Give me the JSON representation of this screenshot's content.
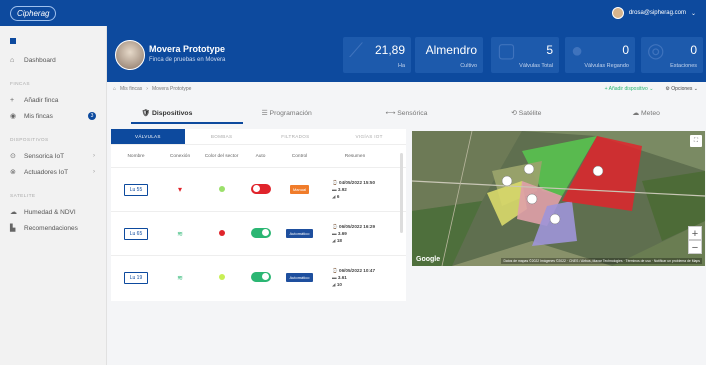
{
  "topbar": {
    "logo": "Cipherag",
    "user_email": "drosa@sipherag.com",
    "user_chevron": "⌄"
  },
  "sidebar": {
    "dashboard": "Dashboard",
    "section_fincas": "FINCAS",
    "add_farm": "Añadir finca",
    "my_farms": "Mis fincas",
    "farms_count": "3",
    "section_dispositivos": "DISPOSITIVOS",
    "sensors": "Sensorica IoT",
    "actuators": "Actuadores IoT",
    "section_satelite": "SATELITE",
    "ndvi": "Humedad & NDVI",
    "recommendations": "Recomendaciones"
  },
  "header": {
    "farm_title": "Movera Prototype",
    "farm_subtitle": "Finca de pruebas en Movera",
    "stats": [
      {
        "value": "21,89",
        "label": "Ha"
      },
      {
        "value": "Almendro",
        "label": "Cultivo"
      },
      {
        "value": "5",
        "label": "Válvulas Total"
      },
      {
        "value": "0",
        "label": "Válvulas Regando"
      },
      {
        "value": "0",
        "label": "Estaciones"
      }
    ]
  },
  "breadcrumb": {
    "home": "Mis fincas",
    "sep": "›",
    "current": "Movera Prototype"
  },
  "actions": {
    "add_device": "+ Añadir dispositivo ⌄",
    "options": "⚙ Opciones ⌄"
  },
  "tabs": [
    "Dispositivos",
    "Programación",
    "Sensórica",
    "Satélite",
    "Meteo"
  ],
  "tab_icons": [
    "🛡",
    "☰",
    "⟷",
    "⟲",
    "☁"
  ],
  "device_tabs": [
    "VÁLVULAS",
    "BOMBAS",
    "FILTRADOS",
    "VIGÍAS IOT"
  ],
  "table": {
    "headers": [
      "Nombre",
      "Conexión",
      "Color del sector",
      "Auto",
      "Control",
      "Resumen"
    ],
    "rows": [
      {
        "name": "Lu 55",
        "wifi": "weak",
        "sector_color": "#9be06b",
        "auto": "off",
        "control": "Manual",
        "control_color": "#f07c2a",
        "date": "04/05/2022 15:50",
        "battery": "3.92",
        "signal": "6"
      },
      {
        "name": "Lu 65",
        "wifi": "ok",
        "sector_color": "#e0242b",
        "auto": "on",
        "control": "Automático",
        "control_color": "#1e4f9e",
        "date": "06/05/2022 16:29",
        "battery": "3.69",
        "signal": "18"
      },
      {
        "name": "Lu 19",
        "wifi": "ok",
        "sector_color": "#c8ef55",
        "auto": "on",
        "control": "Automático",
        "control_color": "#1e4f9e",
        "date": "06/05/2022 10:47",
        "battery": "3.61",
        "signal": "10"
      }
    ]
  },
  "map": {
    "provider": "Google",
    "credit": "Datos de mapas ©2022 Imágenes ©2022 · CNES / Airbus, Maxar Technologies · Términos de uso · Notificar un problema de Maps",
    "zoom_in": "+",
    "zoom_out": "−",
    "fullscreen": "⛶"
  },
  "colors": {
    "primary": "#0d4a9e"
  }
}
